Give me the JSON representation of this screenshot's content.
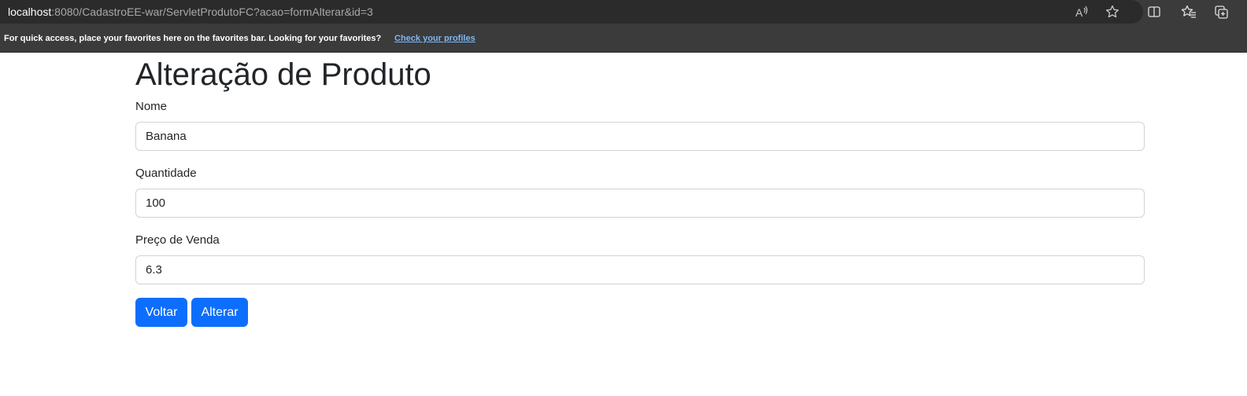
{
  "browser": {
    "url_host": "localhost",
    "url_rest": ":8080/CadastroEE-war/ServletProdutoFC?acao=formAlterar&id=3",
    "icons": [
      "read-aloud-icon",
      "add-favorite-icon",
      "split-screen-icon",
      "favorites-icon",
      "collections-icon"
    ]
  },
  "favorites_bar": {
    "message": "For quick access, place your favorites here on the favorites bar. Looking for your favorites?",
    "link_label": "Check your profiles"
  },
  "form": {
    "title": "Alteração de Produto",
    "fields": [
      {
        "label": "Nome",
        "value": "Banana"
      },
      {
        "label": "Quantidade",
        "value": "100"
      },
      {
        "label": "Preço de Venda",
        "value": "6.3"
      }
    ],
    "buttons": {
      "back_label": "Voltar",
      "submit_label": "Alterar"
    }
  },
  "colors": {
    "primary": "#0d6efd",
    "text": "#212529",
    "chrome_dark": "#2b2b2b",
    "chrome_bar": "#3b3b3b",
    "link": "#7cb7f2"
  }
}
